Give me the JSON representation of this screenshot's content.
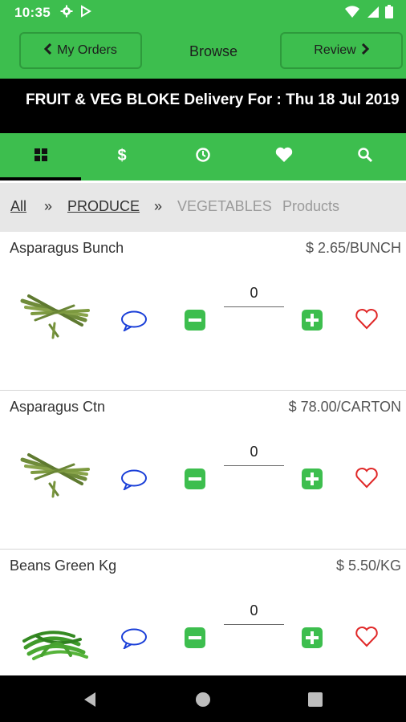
{
  "status_bar": {
    "time": "10:35"
  },
  "header": {
    "left_button": "My Orders",
    "title": "Browse",
    "right_button": "Review"
  },
  "banner": {
    "text": "FRUIT & VEG BLOKE Delivery For : Thu 18 Jul 2019"
  },
  "tabs": [
    {
      "icon": "grid-icon",
      "active": true
    },
    {
      "icon": "dollar-icon",
      "active": false
    },
    {
      "icon": "clock-icon",
      "active": false
    },
    {
      "icon": "heart-icon",
      "active": false
    },
    {
      "icon": "search-icon",
      "active": false
    }
  ],
  "breadcrumb": {
    "all": "All",
    "sep": "»",
    "produce": "PRODUCE",
    "current": "VEGETABLES",
    "suffix": "Products"
  },
  "products": [
    {
      "name": "Asparagus Bunch",
      "price": "$ 2.65/BUNCH",
      "qty": "0",
      "image": "asparagus"
    },
    {
      "name": "Asparagus Ctn",
      "price": "$ 78.00/CARTON",
      "qty": "0",
      "image": "asparagus"
    },
    {
      "name": "Beans Green Kg",
      "price": "$ 5.50/KG",
      "qty": "0",
      "image": "green-beans"
    }
  ],
  "colors": {
    "primary_green": "#3dbe4e",
    "heart_red": "#e02828",
    "chat_blue": "#1a3fd8"
  }
}
